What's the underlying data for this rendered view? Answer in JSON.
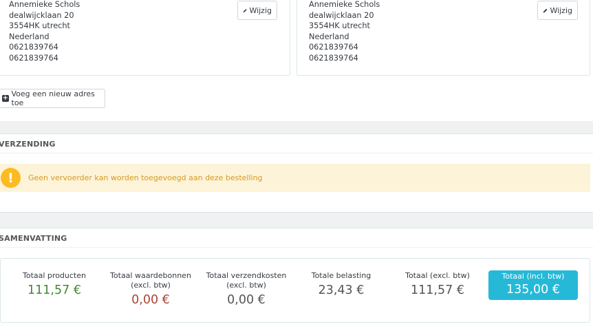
{
  "addresses": [
    {
      "lines": [
        "Annemieke Schols",
        "dealwijcklaan 20",
        "3554HK utrecht",
        "Nederland",
        "0621839764",
        "0621839764"
      ],
      "edit_label": "Wijzig"
    },
    {
      "lines": [
        "Annemieke Schols",
        "dealwijcklaan 20",
        "3554HK utrecht",
        "Nederland",
        "0621839764",
        "0621839764"
      ],
      "edit_label": "Wijzig"
    }
  ],
  "add_address_label": "Voeg een nieuw adres toe",
  "shipping": {
    "heading": "VERZENDING",
    "warning_icon": "!",
    "warning_text": "Geen vervoerder kan worden toegevoegd aan deze bestelling"
  },
  "summary": {
    "heading": "SAMENVATTING",
    "totals": [
      {
        "label": "Totaal producten",
        "value": "111,57 €"
      },
      {
        "label": "Totaal waardebonnen",
        "sublabel": "(excl. btw)",
        "value": "0,00 €"
      },
      {
        "label": "Totaal verzendkosten",
        "sublabel": "(excl. btw)",
        "value": "0,00 €"
      },
      {
        "label": "Totale belasting",
        "value": "23,43 €"
      },
      {
        "label": "Totaal (excl. btw)",
        "value": "111,57 €"
      },
      {
        "label": "Totaal (incl. btw)",
        "value": "135,00 €"
      }
    ]
  },
  "colors": {
    "accent": "#25b9d7",
    "warning": "#fbbb22",
    "positive": "#3f8a2f",
    "negative": "#a94433"
  }
}
